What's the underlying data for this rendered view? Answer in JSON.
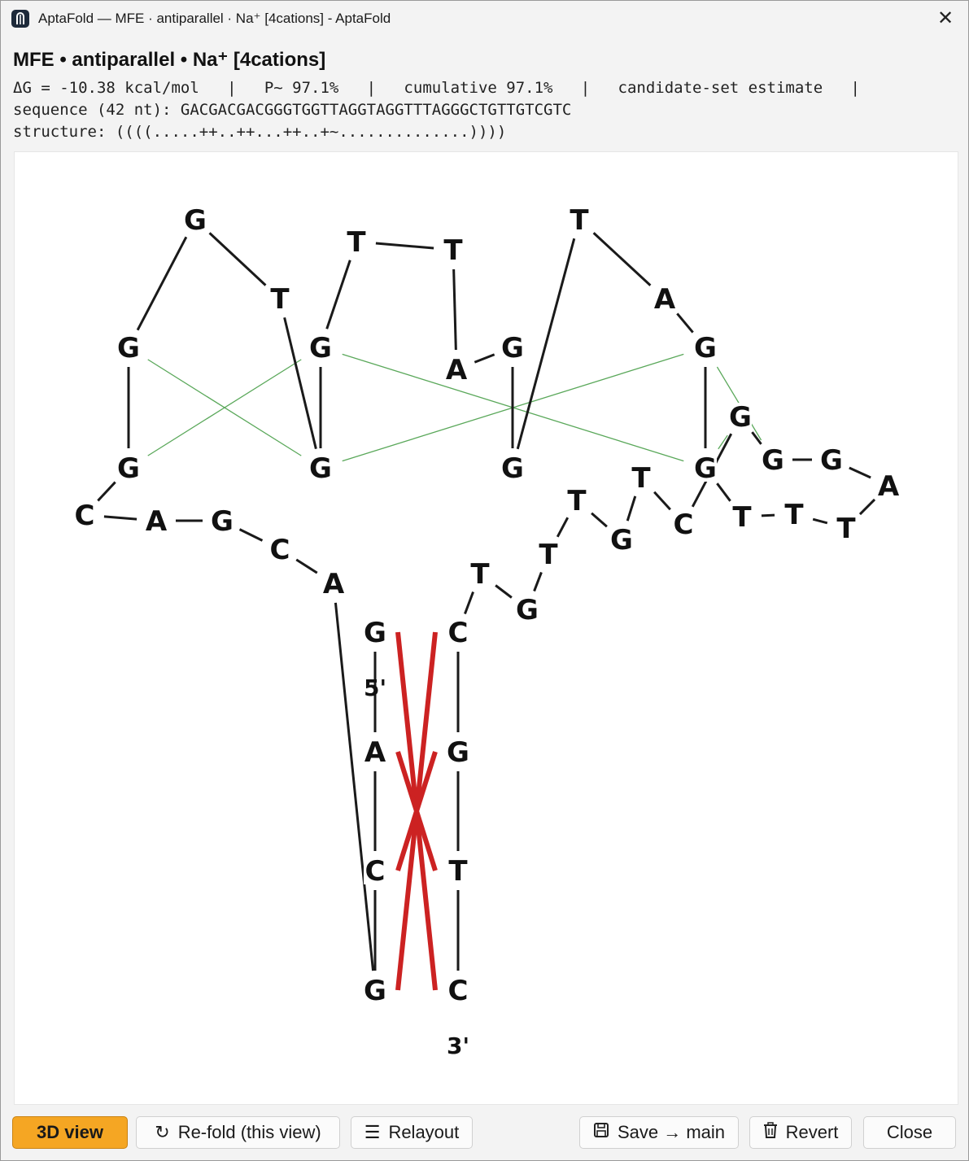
{
  "window": {
    "title": "AptaFold — MFE · antiparallel · Na⁺ [4cations] - AptaFold",
    "close_glyph": "✕",
    "app_icon": "aptafold-logo-icon"
  },
  "header": {
    "headline": "MFE • antiparallel • Na⁺ [4cations]",
    "stats_line": "ΔG = -10.38 kcal/mol   |   P~ 97.1%   |   cumulative 97.1%   |   candidate-set estimate   |",
    "sequence_line": "sequence (42 nt): GACGACGACGGGTGGTTAGGTAGGTTTAGGGCTGTTGTCGTC",
    "structure_line": "structure: ((((.....++..++...++..+~..............))))"
  },
  "diagram": {
    "colors": {
      "backbone": "#1a1a1a",
      "pair": "#cc2222",
      "tetrad": "#5aa85a"
    },
    "nucleotides": [
      {
        "b": "G"
      },
      {
        "b": "A"
      },
      {
        "b": "C"
      },
      {
        "b": "G"
      },
      {
        "b": "A"
      },
      {
        "b": "C"
      },
      {
        "b": "G"
      },
      {
        "b": "A"
      },
      {
        "b": "C"
      },
      {
        "b": "G"
      },
      {
        "b": "G"
      },
      {
        "b": "G"
      },
      {
        "b": "T"
      },
      {
        "b": "G"
      },
      {
        "b": "G"
      },
      {
        "b": "T"
      },
      {
        "b": "T"
      },
      {
        "b": "A"
      },
      {
        "b": "G"
      },
      {
        "b": "G"
      },
      {
        "b": "T"
      },
      {
        "b": "A"
      },
      {
        "b": "G"
      },
      {
        "b": "G"
      },
      {
        "b": "T"
      },
      {
        "b": "T"
      },
      {
        "b": "T"
      },
      {
        "b": "A"
      },
      {
        "b": "G"
      },
      {
        "b": "G"
      },
      {
        "b": "G"
      },
      {
        "b": "C"
      },
      {
        "b": "T"
      },
      {
        "b": "G"
      },
      {
        "b": "T"
      },
      {
        "b": "T"
      },
      {
        "b": "G"
      },
      {
        "b": "T"
      },
      {
        "b": "C"
      },
      {
        "b": "G"
      },
      {
        "b": "T"
      },
      {
        "b": "C"
      }
    ],
    "base_pairs": [
      [
        0,
        41
      ],
      [
        1,
        40
      ],
      [
        2,
        39
      ],
      [
        3,
        38
      ]
    ],
    "tetrad_rows": [
      [
        10,
        13,
        22,
        29
      ],
      [
        9,
        14,
        23,
        30
      ]
    ],
    "five_prime": "5'",
    "three_prime": "3'"
  },
  "toolbar": {
    "view3d": "3D view",
    "refold": "Re-fold (this view)",
    "relayout": "Relayout",
    "save": "Save → main",
    "revert": "Revert",
    "close": "Close",
    "refold_icon": "↻",
    "relayout_icon": "☰",
    "save_icon": "floppy-disk-icon",
    "revert_icon": "trash-icon"
  }
}
